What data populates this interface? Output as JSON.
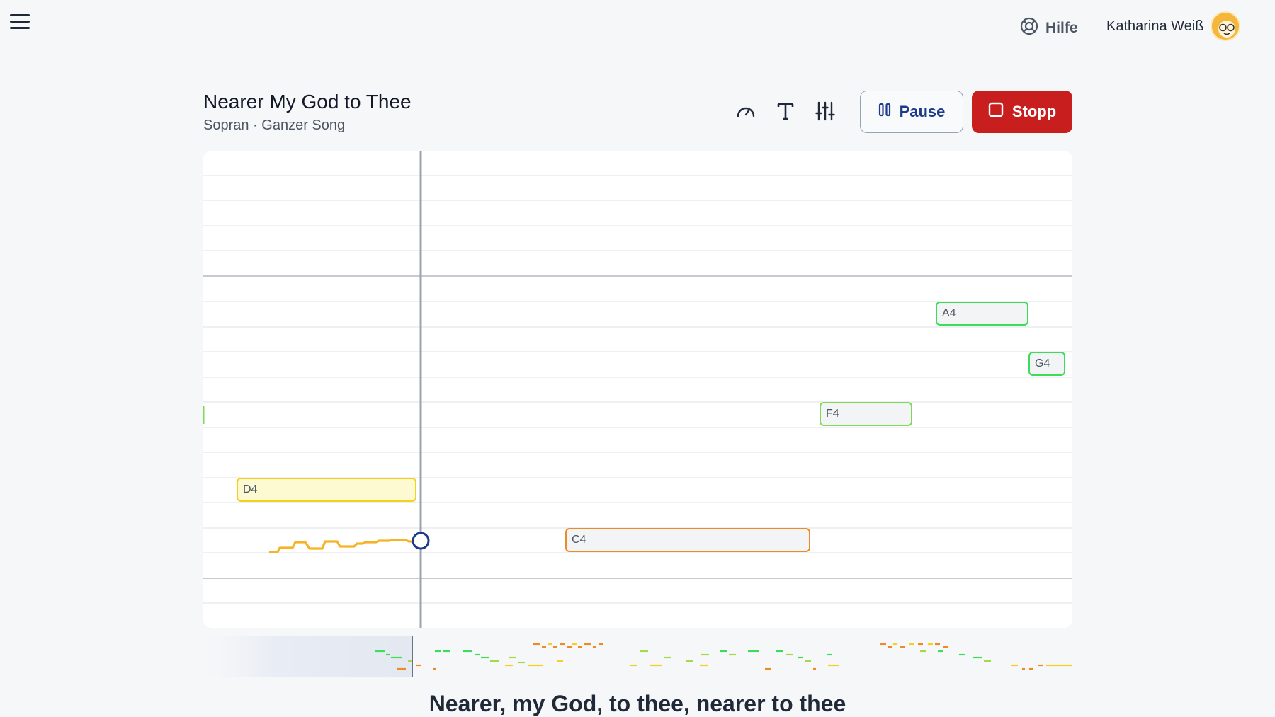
{
  "header": {
    "help_label": "Hilfe",
    "user_name": "Katharina Weiß"
  },
  "song": {
    "title": "Nearer My God to Thee",
    "subtitle": "Sopran · Ganzer Song"
  },
  "controls": {
    "pause_label": "Pause",
    "stop_label": "Stopp"
  },
  "notes": [
    {
      "name": "D4",
      "status": "current",
      "color": "#f5d020"
    },
    {
      "name": "C4",
      "status": "upcoming",
      "color": "#f08a24"
    },
    {
      "name": "F4",
      "status": "upcoming",
      "color": "#7ed957"
    },
    {
      "name": "A4",
      "status": "upcoming",
      "color": "#3ddc5a"
    },
    {
      "name": "G4",
      "status": "upcoming",
      "color": "#3ddc5a"
    }
  ],
  "lyrics": {
    "current_line": "Nearer, my God, to thee, nearer to thee"
  },
  "colors": {
    "stop": "#c81e1e",
    "pause_text": "#1e3a8a",
    "pitch_trace": "#f5b325",
    "playhead_marker": "#1e3a8a"
  }
}
